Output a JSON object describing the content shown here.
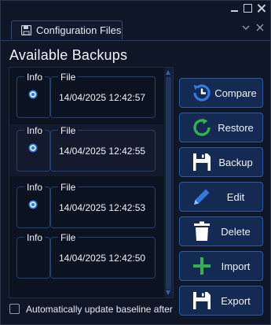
{
  "tab": {
    "label": "Configuration Files"
  },
  "panel": {
    "title": "Available Backups"
  },
  "list": {
    "info_label": "Info",
    "file_label": "File",
    "rows": [
      {
        "file": "14/04/2025 12:42:57",
        "has_restore_icon": true
      },
      {
        "file": "14/04/2025 12:42:55",
        "has_restore_icon": true
      },
      {
        "file": "14/04/2025 12:42:53",
        "has_restore_icon": true
      },
      {
        "file": "14/04/2025 12:42:50",
        "has_restore_icon": false
      }
    ]
  },
  "buttons": {
    "compare": {
      "label": "Compare",
      "icon": "clock-history-icon"
    },
    "restore": {
      "label": "Restore",
      "icon": "refresh-icon"
    },
    "backup": {
      "label": "Backup",
      "icon": "floppy-disk-icon"
    },
    "edit": {
      "label": "Edit",
      "icon": "pencil-icon"
    },
    "delete": {
      "label": "Delete",
      "icon": "trash-icon"
    },
    "import": {
      "label": "Import",
      "icon": "plus-icon"
    },
    "export": {
      "label": "Export",
      "icon": "floppy-disk-icon"
    }
  },
  "auto_update": {
    "label": "Automatically update baseline after",
    "checked": false
  },
  "colors": {
    "accent": "#2f5aa8",
    "button_bg": "#152a52",
    "green": "#2fb34a",
    "blue": "#2f7be0"
  }
}
